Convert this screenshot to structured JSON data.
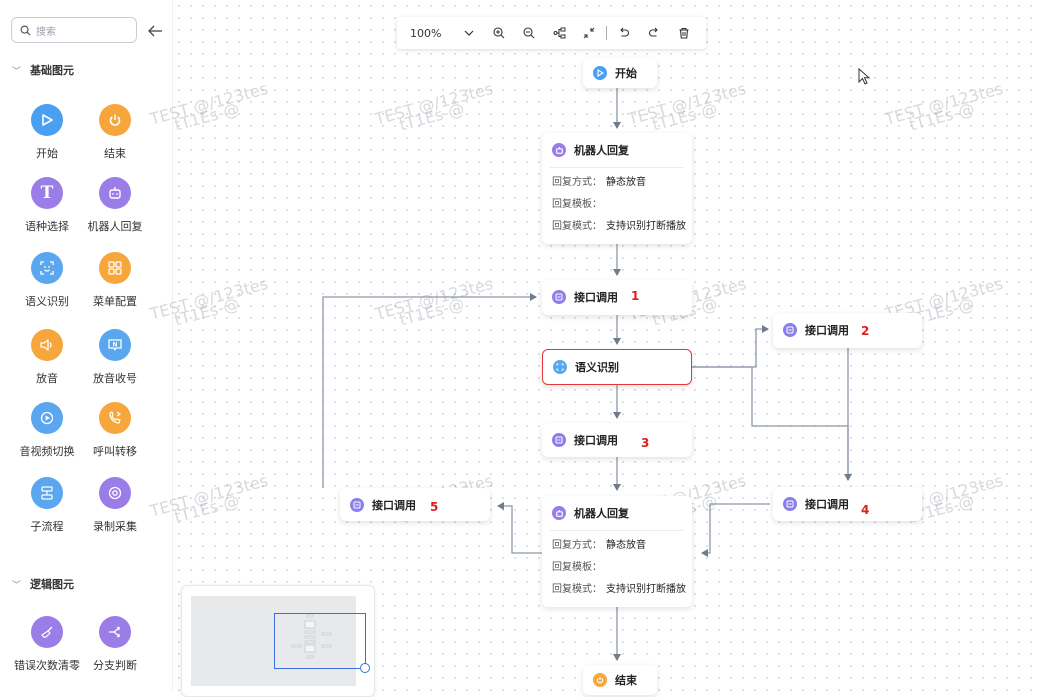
{
  "sidebar": {
    "search_placeholder": "搜索",
    "section_basic": "基础图元",
    "section_logic": "逻辑图元",
    "items": [
      {
        "label": "开始"
      },
      {
        "label": "结束"
      },
      {
        "label": "语种选择"
      },
      {
        "label": "机器人回复"
      },
      {
        "label": "语义识别"
      },
      {
        "label": "菜单配置"
      },
      {
        "label": "放音"
      },
      {
        "label": "放音收号"
      },
      {
        "label": "音视频切换"
      },
      {
        "label": "呼叫转移"
      },
      {
        "label": "子流程"
      },
      {
        "label": "录制采集"
      }
    ],
    "logic_items": [
      {
        "label": "错误次数清零"
      },
      {
        "label": "分支判断"
      }
    ]
  },
  "toolbar": {
    "zoom": "100%"
  },
  "watermark": {
    "line1": "TEST @/123tes",
    "line2": "tT1Es-@"
  },
  "nodes": {
    "start": {
      "title": "开始"
    },
    "robot1": {
      "title": "机器人回复",
      "row1_label": "回复方式：",
      "row1_value": "静态放音",
      "row2_label": "回复模板：",
      "row3_label": "回复模式：",
      "row3_value": "支持识别打断播放"
    },
    "api1": {
      "title": "接口调用",
      "badge": "1"
    },
    "api2": {
      "title": "接口调用",
      "badge": "2"
    },
    "semantic": {
      "title": "语义识别"
    },
    "api3": {
      "title": "接口调用",
      "badge": "3"
    },
    "api4": {
      "title": "接口调用",
      "badge": "4"
    },
    "api5": {
      "title": "接口调用",
      "badge": "5"
    },
    "robot2": {
      "title": "机器人回复",
      "row1_label": "回复方式：",
      "row1_value": "静态放音",
      "row2_label": "回复模板：",
      "row3_label": "回复模式：",
      "row3_value": "支持识别打断播放"
    },
    "end": {
      "title": "结束"
    }
  },
  "colors": {
    "accent": "#3b6fe0",
    "start_blue": "#4b9ff0",
    "end_orange": "#f7a63c",
    "robot_purple": "#9b7de8",
    "api_purple": "#8a7ee8",
    "semantic_blue": "#5aa7ef",
    "selected_border": "#e5373d",
    "badge_red": "#e01e1e"
  }
}
